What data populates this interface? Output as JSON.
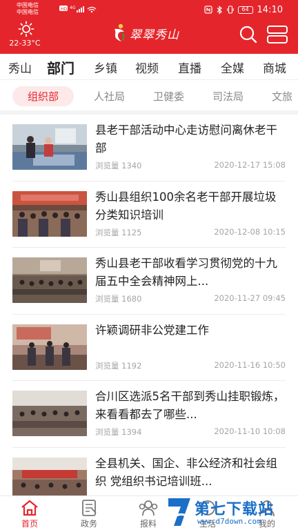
{
  "status_bar": {
    "carrier_1": "中国电信",
    "carrier_2": "中国电信",
    "hd_badge": "HD",
    "network": "4G",
    "battery": "64",
    "time": "14:10"
  },
  "header": {
    "weather_temp": "22-33°C",
    "logo_text": "翠翠秀山"
  },
  "channels": [
    "秀山",
    "部门",
    "乡镇",
    "视频",
    "直播",
    "全媒",
    "商城"
  ],
  "active_channel": "部门",
  "subtabs": [
    "组织部",
    "人社局",
    "卫健委",
    "司法局",
    "文旅"
  ],
  "active_subtab": "组织部",
  "news": [
    {
      "title": "县老干部活动中心走访慰问离休老干部",
      "views_label": "浏览量",
      "views": "1340",
      "date": "2020-12-17 15:08"
    },
    {
      "title": "秀山县组织100余名老干部开展垃圾分类知识培训",
      "views_label": "浏览量",
      "views": "1125",
      "date": "2020-12-08 10:15"
    },
    {
      "title": "秀山县老干部收看学习贯彻党的十九届五中全会精神网上...",
      "views_label": "浏览量",
      "views": "1680",
      "date": "2020-11-27 09:45"
    },
    {
      "title": "许颖调研非公党建工作",
      "views_label": "浏览量",
      "views": "1192",
      "date": "2020-11-16 10:50"
    },
    {
      "title": "合川区选派5名干部到秀山挂职锻炼，来看看都去了哪些...",
      "views_label": "浏览量",
      "views": "1394",
      "date": "2020-11-10 10:08"
    },
    {
      "title": "全县机关、国企、非公经济和社会组织 党组织书记培训班...",
      "views_label": "",
      "views": "",
      "date": ""
    }
  ],
  "bottom_nav": [
    "首页",
    "政务",
    "报料",
    "生活",
    "我的"
  ],
  "active_nav": "首页",
  "watermark": {
    "text": "第七下载站",
    "url": "www.d7down.com"
  },
  "colors": {
    "brand_red": "#e4262c",
    "watermark_blue": "#1b6fc8"
  }
}
